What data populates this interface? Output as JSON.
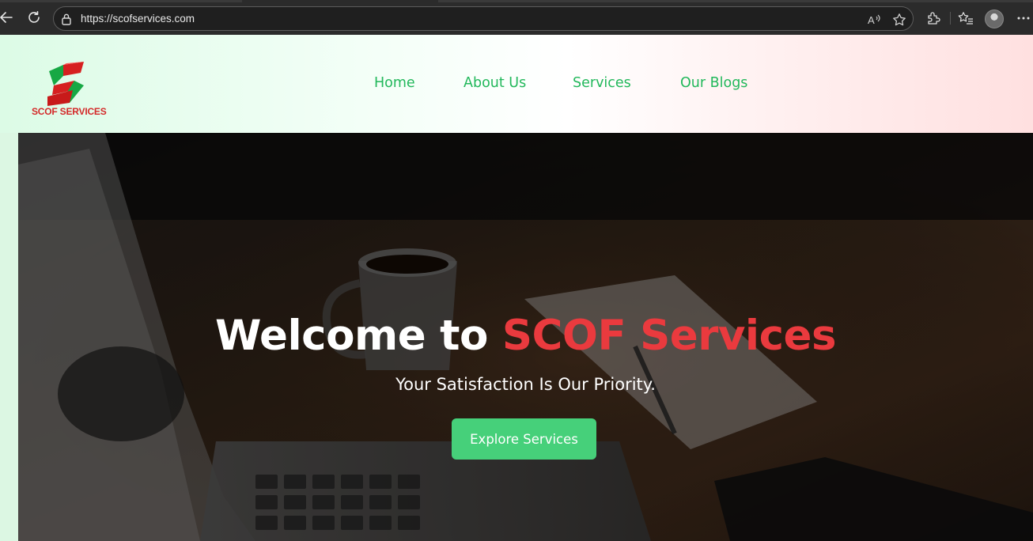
{
  "browser": {
    "url": "https://scofservices.com",
    "icons": [
      "back-arrow-icon",
      "refresh-icon",
      "lock-icon",
      "read-aloud-icon",
      "favorite-star-icon",
      "extensions-icon",
      "favorites-list-icon",
      "profile-avatar",
      "more-menu-icon"
    ]
  },
  "site": {
    "logo_text": "SCOF SERVICES",
    "nav": [
      {
        "label": "Home"
      },
      {
        "label": "About Us"
      },
      {
        "label": "Services"
      },
      {
        "label": "Our Blogs"
      }
    ],
    "colors": {
      "nav_green": "#22b85b",
      "accent_red": "#ea3a3e",
      "button_green": "#46d07a"
    }
  },
  "hero": {
    "title_prefix": "Welcome to",
    "title_accent": "SCOF Services",
    "subtitle": "Your Satisfaction Is Our Priority.",
    "cta_label": "Explore Services"
  }
}
